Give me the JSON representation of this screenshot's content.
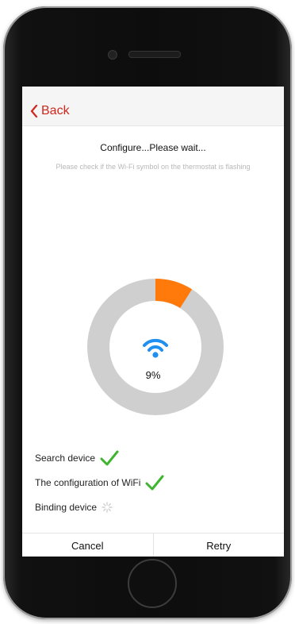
{
  "navbar": {
    "back_label": "Back"
  },
  "header": {
    "title": "Configure...Please wait...",
    "subtitle": "Please check if the Wi-Fi symbol on the thermostat is flashing"
  },
  "progress": {
    "percent": 9,
    "percent_label": "9%",
    "colors": {
      "track": "#cfcfcf",
      "fill": "#ff7a0a",
      "wifi": "#1f8ff0"
    }
  },
  "steps": [
    {
      "label": "Search device",
      "status": "done",
      "icon": "check-icon"
    },
    {
      "label": "The configuration of WiFi",
      "status": "done",
      "icon": "check-icon"
    },
    {
      "label": "Binding device",
      "status": "loading",
      "icon": "spinner-icon"
    }
  ],
  "footer": {
    "cancel_label": "Cancel",
    "retry_label": "Retry"
  },
  "colors": {
    "accent": "#d0271d",
    "check": "#3fb52f"
  }
}
